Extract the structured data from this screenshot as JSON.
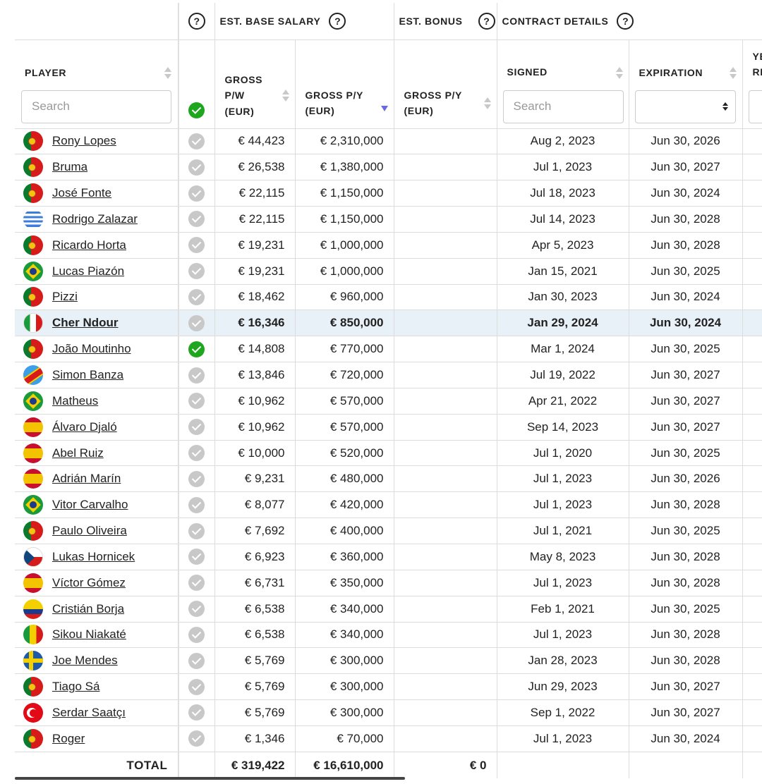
{
  "header": {
    "group_info": "?",
    "group_base_salary": "EST. BASE SALARY",
    "group_bonus": "EST. BONUS",
    "group_contract": "CONTRACT DETAILS",
    "col_player": "PLAYER",
    "col_gross_pw_l1": "GROSS",
    "col_gross_pw_l2": "P/W",
    "col_gross_pw_l3": "(EUR)",
    "col_gross_py_l1": "GROSS P/Y",
    "col_gross_py_l2": "(EUR)",
    "col_bonus_py_l1": "GROSS P/Y",
    "col_bonus_py_l2": "(EUR)",
    "col_signed": "SIGNED",
    "col_expiration": "EXPIRATION",
    "col_years_l1": "YE",
    "col_years_l2": "RE",
    "player_search_placeholder": "Search",
    "signed_search_placeholder": "Search"
  },
  "rows": [
    {
      "name": "Rony Lopes",
      "flag": "portugal",
      "checked": false,
      "pw": "€ 44,423",
      "py": "€ 2,310,000",
      "signed": "Aug 2, 2023",
      "exp": "Jun 30, 2026"
    },
    {
      "name": "Bruma",
      "flag": "portugal",
      "checked": false,
      "pw": "€ 26,538",
      "py": "€ 1,380,000",
      "signed": "Jul 1, 2023",
      "exp": "Jun 30, 2027"
    },
    {
      "name": "José Fonte",
      "flag": "portugal",
      "checked": false,
      "pw": "€ 22,115",
      "py": "€ 1,150,000",
      "signed": "Jul 18, 2023",
      "exp": "Jun 30, 2024"
    },
    {
      "name": "Rodrigo Zalazar",
      "flag": "uruguay",
      "checked": false,
      "pw": "€ 22,115",
      "py": "€ 1,150,000",
      "signed": "Jul 14, 2023",
      "exp": "Jun 30, 2028"
    },
    {
      "name": "Ricardo Horta",
      "flag": "portugal",
      "checked": false,
      "pw": "€ 19,231",
      "py": "€ 1,000,000",
      "signed": "Apr 5, 2023",
      "exp": "Jun 30, 2028"
    },
    {
      "name": "Lucas Piazón",
      "flag": "brazil",
      "checked": false,
      "pw": "€ 19,231",
      "py": "€ 1,000,000",
      "signed": "Jan 15, 2021",
      "exp": "Jun 30, 2025"
    },
    {
      "name": "Pizzi",
      "flag": "portugal",
      "checked": false,
      "pw": "€ 18,462",
      "py": "€ 960,000",
      "signed": "Jan 30, 2023",
      "exp": "Jun 30, 2024"
    },
    {
      "name": "Cher Ndour",
      "flag": "italy",
      "checked": false,
      "highlight": true,
      "pw": "€ 16,346",
      "py": "€ 850,000",
      "signed": "Jan 29, 2024",
      "exp": "Jun 30, 2024"
    },
    {
      "name": "João Moutinho",
      "flag": "portugal",
      "checked": true,
      "pw": "€ 14,808",
      "py": "€ 770,000",
      "signed": "Mar 1, 2024",
      "exp": "Jun 30, 2025"
    },
    {
      "name": "Simon Banza",
      "flag": "drcongo",
      "checked": false,
      "pw": "€ 13,846",
      "py": "€ 720,000",
      "signed": "Jul 19, 2022",
      "exp": "Jun 30, 2027"
    },
    {
      "name": "Matheus",
      "flag": "brazil",
      "checked": false,
      "pw": "€ 10,962",
      "py": "€ 570,000",
      "signed": "Apr 21, 2022",
      "exp": "Jun 30, 2027"
    },
    {
      "name": "Álvaro Djaló",
      "flag": "spain",
      "checked": false,
      "pw": "€ 10,962",
      "py": "€ 570,000",
      "signed": "Sep 14, 2023",
      "exp": "Jun 30, 2027"
    },
    {
      "name": "Abel Ruiz",
      "flag": "spain",
      "checked": false,
      "pw": "€ 10,000",
      "py": "€ 520,000",
      "signed": "Jul 1, 2020",
      "exp": "Jun 30, 2025"
    },
    {
      "name": "Adrián Marín",
      "flag": "spain",
      "checked": false,
      "pw": "€ 9,231",
      "py": "€ 480,000",
      "signed": "Jul 1, 2023",
      "exp": "Jun 30, 2026"
    },
    {
      "name": "Vitor Carvalho",
      "flag": "brazil",
      "checked": false,
      "pw": "€ 8,077",
      "py": "€ 420,000",
      "signed": "Jul 1, 2023",
      "exp": "Jun 30, 2028"
    },
    {
      "name": "Paulo Oliveira",
      "flag": "portugal",
      "checked": false,
      "pw": "€ 7,692",
      "py": "€ 400,000",
      "signed": "Jul 1, 2021",
      "exp": "Jun 30, 2025"
    },
    {
      "name": "Lukas Hornicek",
      "flag": "czechia",
      "checked": false,
      "pw": "€ 6,923",
      "py": "€ 360,000",
      "signed": "May 8, 2023",
      "exp": "Jun 30, 2028"
    },
    {
      "name": "Víctor Gómez",
      "flag": "spain",
      "checked": false,
      "pw": "€ 6,731",
      "py": "€ 350,000",
      "signed": "Jul 1, 2023",
      "exp": "Jun 30, 2028"
    },
    {
      "name": "Cristián Borja",
      "flag": "colombia",
      "checked": false,
      "pw": "€ 6,538",
      "py": "€ 340,000",
      "signed": "Feb 1, 2021",
      "exp": "Jun 30, 2025"
    },
    {
      "name": "Sikou Niakaté",
      "flag": "mali",
      "checked": false,
      "pw": "€ 6,538",
      "py": "€ 340,000",
      "signed": "Jul 1, 2023",
      "exp": "Jun 30, 2028"
    },
    {
      "name": "Joe Mendes",
      "flag": "sweden",
      "checked": false,
      "pw": "€ 5,769",
      "py": "€ 300,000",
      "signed": "Jan 28, 2023",
      "exp": "Jun 30, 2028"
    },
    {
      "name": "Tiago Sá",
      "flag": "portugal",
      "checked": false,
      "pw": "€ 5,769",
      "py": "€ 300,000",
      "signed": "Jun 29, 2023",
      "exp": "Jun 30, 2027"
    },
    {
      "name": "Serdar Saatçı",
      "flag": "turkey",
      "checked": false,
      "pw": "€ 5,769",
      "py": "€ 300,000",
      "signed": "Sep 1, 2022",
      "exp": "Jun 30, 2027"
    },
    {
      "name": "Roger",
      "flag": "portugal",
      "checked": false,
      "pw": "€ 1,346",
      "py": "€ 70,000",
      "signed": "Jul 1, 2023",
      "exp": "Jun 30, 2024"
    }
  ],
  "footer": {
    "label": "TOTAL",
    "pw": "€ 319,422",
    "py": "€ 16,610,000",
    "bonus": "€ 0"
  },
  "colors": {
    "check_on": "#1ea61e",
    "check_off": "#c8c8c8",
    "highlight_row": "#e8f0f8",
    "sort_active": "#6a6adf"
  }
}
